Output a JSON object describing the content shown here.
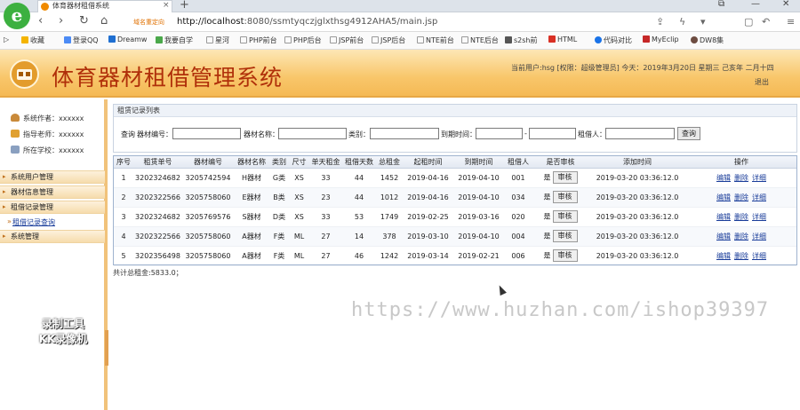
{
  "browser": {
    "tab_title": "体育器材租借系统",
    "secure_label": "域名重定向",
    "url_host": "http://localhost",
    "url_path": ":8080/ssmtyqczjglxthsg4912AHA5/main.jsp",
    "bookmarks": [
      "收藏",
      "登录QQ",
      "Dreamw",
      "我要自学",
      "星河",
      "PHP前台",
      "PHP后台",
      "JSP前台",
      "JSP后台",
      "NTE前台",
      "NTE后台",
      "s2sh前",
      "HTML",
      "代码对比",
      "MyEclip",
      "DW8集"
    ]
  },
  "header": {
    "title": "体育器材租借管理系统",
    "user_info": "当前用户:hsg [权限：超级管理员] 今天：2019年3月20日 星期三 己亥年 二月十四",
    "logout": "退出"
  },
  "sidebar": {
    "author": "系统作者：xxxxxx",
    "teacher": "指导老师：xxxxxx",
    "school": "所在学校：xxxxxx",
    "sections": [
      "系统用户管理",
      "器材信息管理",
      "租借记录管理"
    ],
    "sub_item": "租借记录查询",
    "last_section": "系统管理"
  },
  "panel": {
    "title": "租赁记录列表",
    "lbl_query": "查询",
    "lbl_equip_no": "器材编号：",
    "lbl_equip_name": "器材名称：",
    "lbl_category": "类别：",
    "lbl_rent_time": "到期时间：",
    "lbl_dash": "-",
    "lbl_renter": "租借人：",
    "btn_query": "查询"
  },
  "table": {
    "headers": [
      "序号",
      "租赁单号",
      "器材编号",
      "器材名称",
      "类别",
      "尺寸",
      "单天租金",
      "租借天数",
      "总租金",
      "起租时间",
      "到期时间",
      "租借人",
      "是否审核",
      "添加时间",
      "操作"
    ],
    "rows": [
      [
        "1",
        "3202324682",
        "3205742594",
        "H器材",
        "G类",
        "XS",
        "33",
        "44",
        "1452",
        "2019-04-16",
        "2019-04-10",
        "001",
        "是",
        "2019-03-20 03:36:12.0"
      ],
      [
        "2",
        "3202322566",
        "3205758060",
        "E器材",
        "B类",
        "XS",
        "23",
        "44",
        "1012",
        "2019-04-16",
        "2019-04-10",
        "034",
        "是",
        "2019-03-20 03:36:12.0"
      ],
      [
        "3",
        "3202324682",
        "3205769576",
        "S器材",
        "D类",
        "XS",
        "33",
        "53",
        "1749",
        "2019-02-25",
        "2019-03-16",
        "020",
        "是",
        "2019-03-20 03:36:12.0"
      ],
      [
        "4",
        "3202322566",
        "3205758060",
        "A器材",
        "F类",
        "ML",
        "27",
        "14",
        "378",
        "2019-03-10",
        "2019-04-10",
        "004",
        "是",
        "2019-03-20 03:36:12.0"
      ],
      [
        "5",
        "3202356498",
        "3205758060",
        "A器材",
        "F类",
        "ML",
        "27",
        "46",
        "1242",
        "2019-03-14",
        "2019-02-21",
        "006",
        "是",
        "2019-03-20 03:36:12.0"
      ]
    ],
    "audit_btn": "审核",
    "op_edit": "编辑",
    "op_delete": "删除",
    "op_detail": "详细"
  },
  "total_text": "共计总租金:5833.0；",
  "overlay": {
    "watermark": "https://www.huzhan.com/ishop39397",
    "recorder_line1": "录制工具",
    "recorder_line2": "KK录像机"
  }
}
